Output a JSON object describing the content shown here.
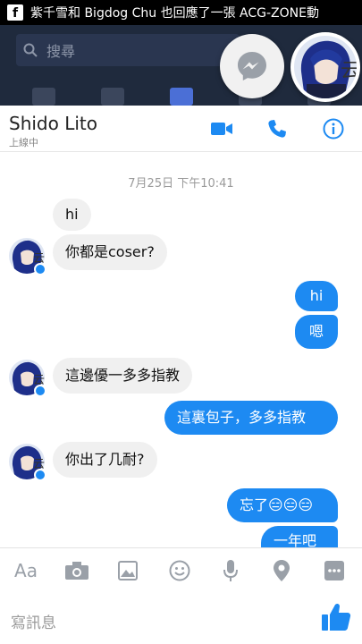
{
  "status_bar": {
    "notification": "紫千雪和 Bigdog Chu 也回應了一張 ACG-ZONE動"
  },
  "underlay": {
    "search_placeholder": "搜尋"
  },
  "chat": {
    "contact_name": "Shido Lito",
    "contact_status": "上線中",
    "timestamp": "7月25日 下午10:41",
    "messages": [
      {
        "from": "them",
        "text": "hi"
      },
      {
        "from": "them",
        "text": "你都是coser?"
      },
      {
        "from": "me",
        "text": "hi"
      },
      {
        "from": "me",
        "text": "嗯"
      },
      {
        "from": "them",
        "text": "這邊優一多多指教"
      },
      {
        "from": "me",
        "text": "這裏包子，多多指教"
      },
      {
        "from": "them",
        "text": "你出了几耐?"
      },
      {
        "from": "me",
        "text": "忘了😑😑😑"
      },
      {
        "from": "me",
        "text": "一年吧"
      }
    ]
  },
  "composer": {
    "text_format_label": "Aa",
    "placeholder": "寫訊息"
  },
  "colors": {
    "accent": "#1d8af2",
    "incoming_bubble": "#f0f0f0",
    "status_bar": "#000000"
  },
  "icons": [
    "facebook-icon",
    "search-icon",
    "messenger-icon",
    "video-call-icon",
    "phone-icon",
    "info-icon",
    "camera-icon",
    "image-icon",
    "emoji-icon",
    "microphone-icon",
    "location-icon",
    "more-icon",
    "thumbs-up-icon"
  ]
}
